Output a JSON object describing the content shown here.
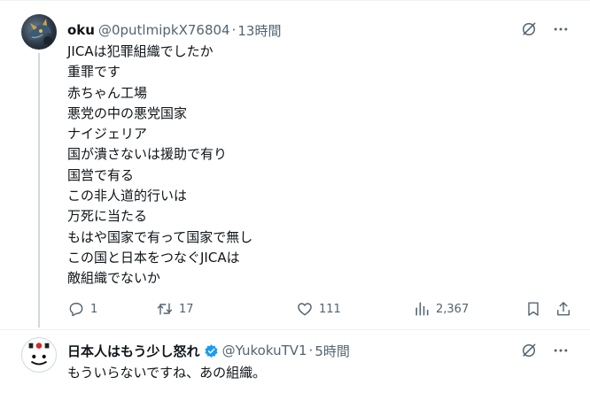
{
  "tweet1": {
    "name": "oku",
    "handle": "@0putlmipkX76804",
    "dot": "·",
    "time": "13時間",
    "lines": [
      "JICAは犯罪組織でしたか",
      "重罪です",
      "赤ちゃん工場",
      "悪党の中の悪党国家",
      "ナイジェリア",
      "国が潰さないは援助で有り",
      "国営で有る",
      "この非人道的行いは",
      "万死に当たる",
      "もはや国家で有って国家で無し",
      "この国と日本をつなぐJICAは",
      "敵組織でないか"
    ],
    "replies": "1",
    "retweets": "17",
    "likes": "111",
    "views": "2,367"
  },
  "tweet2": {
    "name": "日本人はもう少し怒れ",
    "handle": "@YukokuTV1",
    "dot": "·",
    "time": "5時間",
    "text": "もういらないですね、あの組織。",
    "verified": true
  },
  "colors": {
    "text": "#0f1419",
    "secondary": "#536471",
    "verified": "#1d9bf0",
    "divider": "#eff3f4",
    "thread": "#cfd9de"
  },
  "icons": [
    "grok-icon",
    "more-icon",
    "reply-icon",
    "retweet-icon",
    "like-icon",
    "views-icon",
    "bookmark-icon",
    "share-icon",
    "verified-badge-icon"
  ]
}
